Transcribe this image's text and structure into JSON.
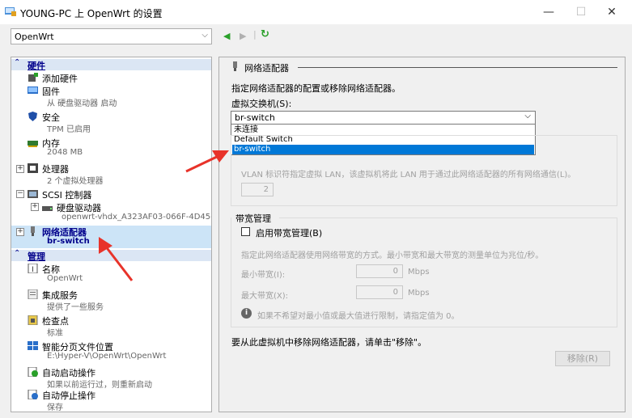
{
  "window": {
    "title": "YOUNG-PC 上 OpenWrt 的设置",
    "minimize": "—",
    "maximize": "☐",
    "close": "✕"
  },
  "toolbar": {
    "vm_name": "OpenWrt",
    "back": "◀",
    "forward": "▶",
    "refresh": "↻"
  },
  "sidebar": {
    "hardware_header": "硬件",
    "management_header": "管理",
    "items": {
      "add_hardware": "添加硬件",
      "firmware": "固件",
      "firmware_sub": "从 硬盘驱动器 启动",
      "security": "安全",
      "security_sub": "TPM 已启用",
      "memory": "内存",
      "memory_sub": "2048 MB",
      "processor": "处理器",
      "processor_sub": "2 个虚拟处理器",
      "scsi": "SCSI 控制器",
      "hdd": "硬盘驱动器",
      "hdd_sub": "openwrt-vhdx_A323AF03-066F-4D45-...",
      "nic": "网络适配器",
      "nic_sub": "br-switch",
      "name": "名称",
      "name_sub": "OpenWrt",
      "integration": "集成服务",
      "integration_sub": "提供了一些服务",
      "checkpoint": "检查点",
      "checkpoint_sub": "标准",
      "paging": "智能分页文件位置",
      "paging_sub": "E:\\Hyper-V\\OpenWrt\\OpenWrt",
      "autostart": "自动启动操作",
      "autostart_sub": "如果以前运行过，则重新启动",
      "autostop": "自动停止操作",
      "autostop_sub": "保存"
    }
  },
  "panel": {
    "section_title": "网络适配器",
    "description": "指定网络适配器的配置或移除网络适配器。",
    "switch_label": "虚拟交换机(S):",
    "switch_value": "br-switch",
    "switch_options": [
      "未连接",
      "Default Switch",
      "br-switch"
    ],
    "vlan_text": "VLAN 标识符指定虚拟 LAN，该虚拟机将此 LAN 用于通过此网络适配器的所有网络通信(L)。",
    "vlan_value": "2",
    "bandwidth_title": "带宽管理",
    "bandwidth_checkbox": "启用带宽管理(B)",
    "bandwidth_desc": "指定此网络适配器使用网络带宽的方式。最小带宽和最大带宽的测量单位为兆位/秒。",
    "min_label": "最小带宽(I):",
    "min_value": "0",
    "max_label": "最大带宽(X):",
    "max_value": "0",
    "unit": "Mbps",
    "info_icon_glyph": "i",
    "info_text": "如果不希望对最小值或最大值进行限制，请指定值为 0。",
    "remove_hint": "要从此虚拟机中移除网络适配器，请单击\"移除\"。",
    "remove_button": "移除(R)"
  },
  "colors": {
    "accent": "#0078d7",
    "annotation_arrow": "#e8332a",
    "section_bg": "#dbe6f4",
    "selected_bg": "#cce4f7"
  }
}
